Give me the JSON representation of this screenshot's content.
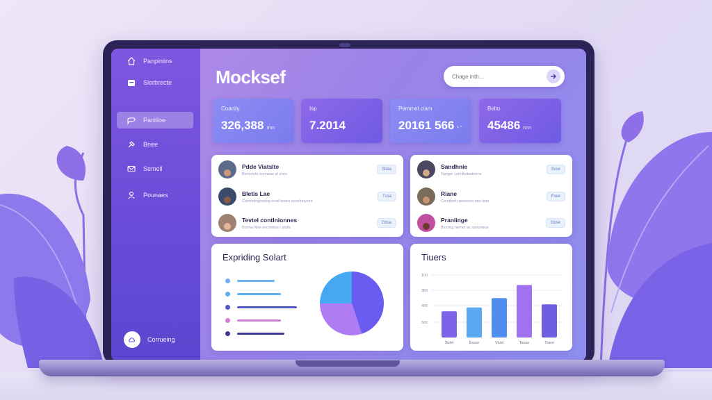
{
  "sidebar": {
    "items": [
      {
        "label": "Panpiniins",
        "icon": "home-icon"
      },
      {
        "label": "Slorbrecte",
        "icon": "folder-icon"
      },
      {
        "label": "Paniiloe",
        "icon": "chat-icon",
        "active": true
      },
      {
        "label": "Bnee",
        "icon": "hammer-icon"
      },
      {
        "label": "Semell",
        "icon": "mail-icon"
      },
      {
        "label": "Pounaes",
        "icon": "person-icon"
      }
    ],
    "footer_label": "Corrueing"
  },
  "header": {
    "title": "Mocksef",
    "search_placeholder": "Chage inth..."
  },
  "stats": [
    {
      "label": "Coanily",
      "value": "326,388",
      "unit": "nnn"
    },
    {
      "label": "Isp",
      "value": "7.2014",
      "unit": ""
    },
    {
      "label": "Pemmel ciam",
      "value": "20161 566",
      "unit": "¹ °"
    },
    {
      "label": "Belto",
      "value": "45486",
      "unit": "nnn"
    }
  ],
  "people_left": [
    {
      "name": "Pdde Viatslte",
      "sub": "Benonuto esnnzoo al snno",
      "pill": "Sbaa"
    },
    {
      "name": "Bletis Lae",
      "sub": "Cormmingreeing ecsd tewcs eccelnnyees",
      "pill": "Tvsa"
    },
    {
      "name": "Tevtel contlnionnes",
      "sub": "Bonna Nne oncnobos t stalls",
      "pill": "Gbsa"
    }
  ],
  "people_right": [
    {
      "name": "Sandhnie",
      "sub": "Spnger celmiletinstnene",
      "pill": "Svse"
    },
    {
      "name": "Riane",
      "sub": "Cennbert peeneurs ono lese",
      "pill": "Fsee"
    },
    {
      "name": "Pranlinge",
      "sub": "Bloctng nerner ac sanuneoe",
      "pill": "Gbse"
    }
  ],
  "colors": {
    "accent": "#7c5ce6",
    "sidebar": "#6a4cd8",
    "bars": [
      "#7b62e8",
      "#5aa8ef",
      "#4f8eef",
      "#a072ee",
      "#6f5fe0"
    ]
  },
  "panels": {
    "spending_title": "Expriding Solart",
    "tiers_title": "Tiuers"
  },
  "chart_data": [
    {
      "type": "pie",
      "title": "Expriding Solart",
      "slices": [
        {
          "value": 45,
          "color": "#6a5cf0"
        },
        {
          "value": 30,
          "color": "#b07cf3"
        },
        {
          "value": 25,
          "color": "#46a8f0"
        }
      ],
      "legend": [
        {
          "color": "#6fb0ef",
          "bar": 0.6
        },
        {
          "color": "#5cb1f2",
          "bar": 0.7
        },
        {
          "color": "#4f58c4",
          "bar": 0.95
        },
        {
          "color": "#d07ed8",
          "bar": 0.7
        },
        {
          "color": "#3b3b90",
          "bar": 0.75
        }
      ]
    },
    {
      "type": "bar",
      "title": "Tiuers",
      "categories": [
        "Solet",
        "Eucre",
        "Vlust",
        "Tseas",
        "Trace"
      ],
      "values": [
        210,
        240,
        315,
        420,
        265
      ],
      "ylim": [
        0,
        500
      ],
      "yticks": [
        "100",
        "350",
        "400",
        "500"
      ],
      "grid": true
    }
  ]
}
